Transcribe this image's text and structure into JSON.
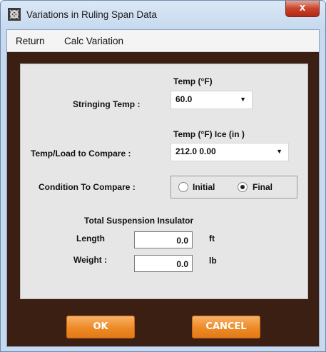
{
  "window": {
    "title": "Variations in Ruling Span Data",
    "close_glyph": "x"
  },
  "menu": {
    "items": [
      "Return",
      "Calc Variation"
    ]
  },
  "form": {
    "stringing_temp": {
      "header": "Temp   (°F)",
      "label": "Stringing Temp :",
      "value": "60.0"
    },
    "compare_load": {
      "header": "Temp  (°F)   Ice   (in )",
      "label": "Temp/Load to Compare :",
      "value": "212.0  0.00"
    },
    "condition": {
      "label": "Condition To Compare :",
      "options": [
        "Initial",
        "Final"
      ],
      "selected": "Final"
    },
    "insulator": {
      "heading": "Total Suspension Insulator",
      "length_label": "Length",
      "length_value": "0.0",
      "length_unit": "ft",
      "weight_label": "Weight :",
      "weight_value": "0.0",
      "weight_unit": "lb"
    }
  },
  "buttons": {
    "ok": "OK",
    "cancel": "CANCEL"
  },
  "colors": {
    "client_bg": "#3c1f13",
    "button_orange": "#ee8a26",
    "panel_bg": "#e6e6e6"
  },
  "icons": {
    "app": "app-logo-icon",
    "dropdown": "dropdown-arrow-icon"
  }
}
